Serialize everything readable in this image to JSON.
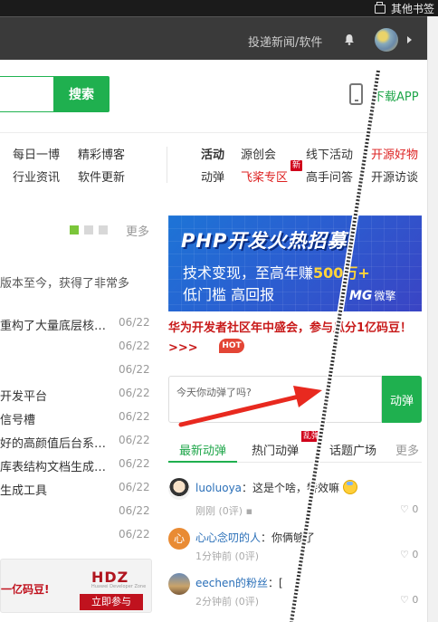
{
  "browser": {
    "other_bookmarks": "其他书签"
  },
  "header": {
    "submit_link": "投递新闻/软件"
  },
  "search": {
    "button": "搜索",
    "download_app": "下载APP"
  },
  "nav_left": [
    "每日一博",
    "精彩博客",
    "行业资讯",
    "软件更新"
  ],
  "nav_right": [
    {
      "label": "活动",
      "style": "bold"
    },
    {
      "label": "源创会",
      "style": "normal"
    },
    {
      "label": "线下活动",
      "style": "normal"
    },
    {
      "label": "开源好物",
      "style": "red"
    },
    {
      "label": "动弹",
      "style": "normal"
    },
    {
      "label": "飞桨专区",
      "style": "red"
    },
    {
      "label": "高手问答",
      "style": "normal"
    },
    {
      "label": "开源访谈",
      "style": "normal"
    }
  ],
  "new_badge": "新",
  "left_news": {
    "more": "更多",
    "intro": "版本至今，获得了非常多",
    "items": [
      {
        "title": "重构了大量底层核…",
        "date": "06/22"
      },
      {
        "title": "",
        "date": "06/22"
      },
      {
        "title": "",
        "date": "06/22"
      },
      {
        "title": "开发平台",
        "date": "06/22"
      },
      {
        "title": "信号槽",
        "date": "06/22"
      },
      {
        "title": "好的高颜值后台系…",
        "date": "06/22"
      },
      {
        "title": "库表结构文档生成…",
        "date": "06/22"
      },
      {
        "title": "生成工具",
        "date": "06/22"
      },
      {
        "title": "",
        "date": "06/22"
      },
      {
        "title": "",
        "date": "06/22"
      }
    ],
    "ad": {
      "text": "一亿码豆!",
      "logo": "HDZ",
      "sub": "Huawei Developer Zone",
      "join": "立即参与"
    }
  },
  "banner": {
    "headline": "PHP开发火热招募",
    "line2_a": "技术变现，至高年赚",
    "line2_b": "500万+",
    "line3": "低门槛 高回报",
    "logo": "MG",
    "logo_sub": "微擎"
  },
  "promo": {
    "text": "华为开发者社区年中盛会，参与瓜分1亿码豆！>>>",
    "hot": "HOT"
  },
  "danmu": {
    "placeholder": "今天你动弹了吗?",
    "button": "动弹"
  },
  "tabs": [
    "最新动弹",
    "热门动弹",
    "话题广场",
    "更多"
  ],
  "luan_badge": "乱弹",
  "feed": [
    {
      "user": "luoluoya",
      "text": "：这是个啥，特效嘛",
      "time": "刚刚",
      "comments": "(0评)",
      "likes": "0"
    },
    {
      "user": "心心念叨的人",
      "text": "：你俩够了",
      "time": "1分钟前",
      "comments": "(0评)",
      "likes": "0"
    },
    {
      "user": "eechen的粉丝",
      "text": "：[",
      "time": "2分钟前",
      "comments": "(0评)",
      "likes": "0"
    }
  ],
  "colors": {
    "accent": "#1fb04f",
    "red": "#d22222",
    "header_bg": "#3a3a3a"
  }
}
